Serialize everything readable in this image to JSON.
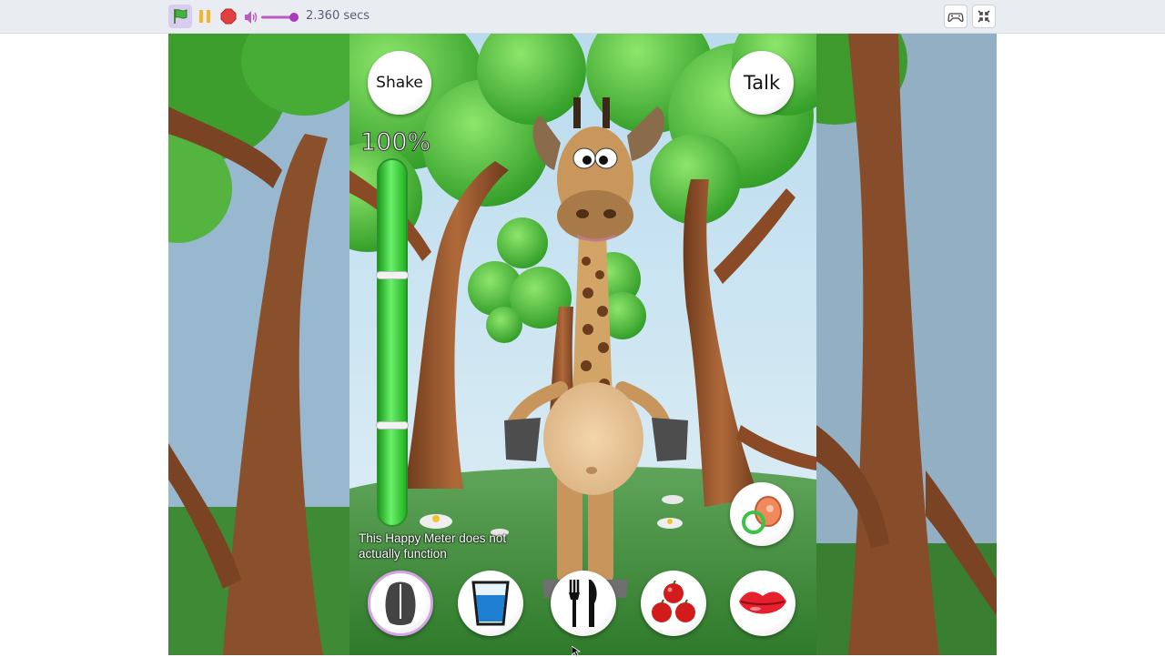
{
  "toolbar": {
    "timer": "2.360 secs",
    "icons": [
      "green-flag-icon",
      "pause-icon",
      "stop-icon",
      "volume-icon",
      "gamepad-icon",
      "fullscreen-exit-icon"
    ]
  },
  "game": {
    "shake_label": "Shake",
    "talk_label": "Talk",
    "happy_meter_value": "100%",
    "happy_meter_level": 1.0,
    "meter_note": "This Happy Meter does not actually function",
    "actions": [
      "sleep-icon",
      "water-glass-icon",
      "fork-knife-icon",
      "apples-icon",
      "lips-icon",
      "pacifier-icon"
    ]
  }
}
